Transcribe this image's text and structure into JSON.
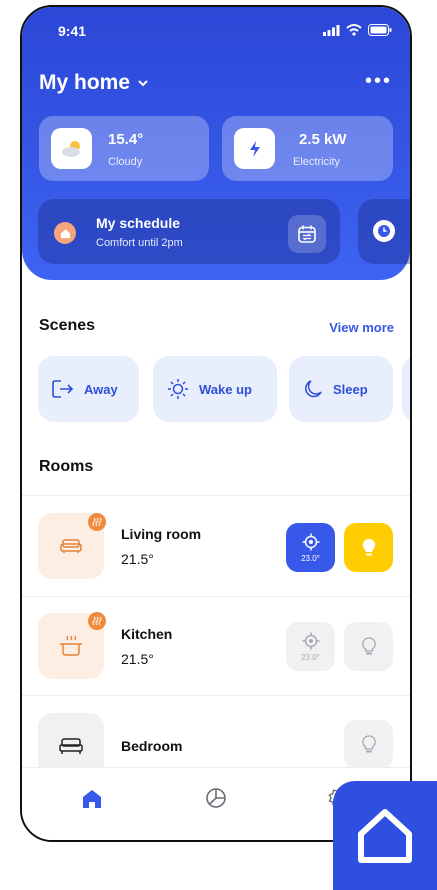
{
  "status": {
    "time": "9:41"
  },
  "header": {
    "title": "My home"
  },
  "weather": {
    "value": "15.4°",
    "label": "Cloudy"
  },
  "electricity": {
    "value": "2.5 kW",
    "label": "Electricity"
  },
  "schedule": {
    "title": "My schedule",
    "subtitle": "Comfort until 2pm"
  },
  "scenes": {
    "title": "Scenes",
    "view_more": "View more",
    "items": [
      {
        "label": "Away",
        "icon": "away-icon"
      },
      {
        "label": "Wake up",
        "icon": "sun-icon"
      },
      {
        "label": "Sleep",
        "icon": "moon-icon"
      }
    ]
  },
  "rooms": {
    "title": "Rooms",
    "items": [
      {
        "name": "Living room",
        "temp": "21.5°",
        "thermostat": "23.0°",
        "thermostat_on": true,
        "light_on": true
      },
      {
        "name": "Kitchen",
        "temp": "21.5°",
        "thermostat": "23.0°",
        "thermostat_on": false,
        "light_on": false
      },
      {
        "name": "Bedroom",
        "light_on": false
      }
    ]
  },
  "colors": {
    "primary": "#3858e9",
    "accent_yellow": "#ffcc00",
    "badge_orange": "#f08a3c",
    "room_bg_warm": "#fdeee3",
    "room_bg_neutral": "#f0f1f3"
  },
  "nav": {
    "items": [
      "home-icon",
      "chart-icon",
      "settings-icon"
    ]
  }
}
